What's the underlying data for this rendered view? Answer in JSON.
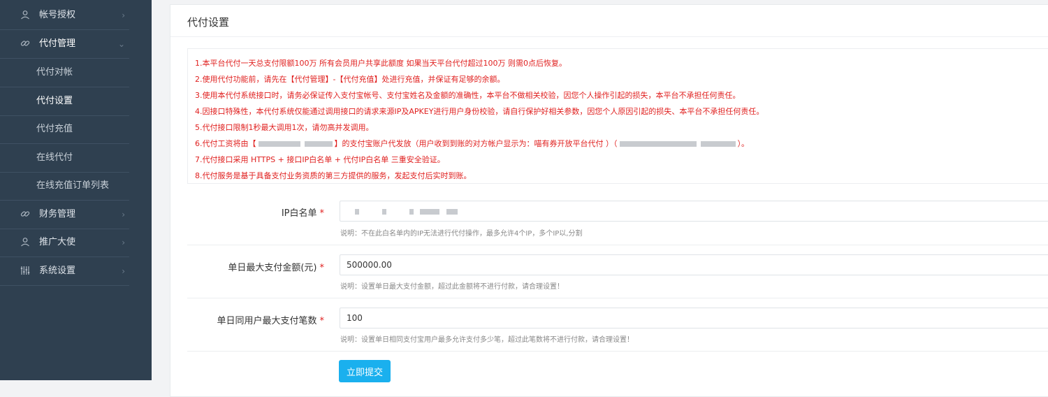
{
  "sidebar": {
    "items": [
      {
        "label": "帐号授权",
        "icon": "user-icon",
        "type": "parent",
        "arrow": "›"
      },
      {
        "label": "代付管理",
        "icon": "link-icon",
        "type": "parent-open",
        "arrow": "⌄"
      },
      {
        "label": "代付对帐",
        "type": "sub"
      },
      {
        "label": "代付设置",
        "type": "sub-active"
      },
      {
        "label": "代付充值",
        "type": "sub"
      },
      {
        "label": "在线代付",
        "type": "sub"
      },
      {
        "label": "在线充值订单列表",
        "type": "sub"
      },
      {
        "label": "财务管理",
        "icon": "link-icon",
        "type": "parent",
        "arrow": "›"
      },
      {
        "label": "推广大使",
        "icon": "user-icon",
        "type": "parent",
        "arrow": "›"
      },
      {
        "label": "系统设置",
        "icon": "sliders-icon",
        "type": "parent",
        "arrow": "›"
      }
    ]
  },
  "panel": {
    "title": "代付设置"
  },
  "notice": {
    "lines": [
      "1.本平台代付一天总支付限额100万 所有会员用户共享此额度 如果当天平台代付超过100万 则需0点后恢复。",
      "2.使用代付功能前，请先在【代付管理】-【代付充值】处进行充值，并保证有足够的余额。",
      "3.使用本代付系统接口时，请务必保证传入支付宝帐号、支付宝姓名及金额的准确性，本平台不做相关校验，因您个人操作引起的损失，本平台不承担任何责任。",
      "4.因接口特殊性，本代付系统仅能通过调用接口的请求来源IP及APKEY进行用户身份校验，请自行保护好相关参数，因您个人原因引起的损失、本平台不承担任何责任。",
      "5.代付接口限制1秒最大调用1次，请勿高并发调用。",
      "6.代付工资将由【",
      "7.代付接口采用 HTTPS + 接口IP白名单 + 代付IP白名单 三重安全验证。",
      "8.代付服务是基于具备支付业务资质的第三方提供的服务，发起支付后实时到账。"
    ],
    "line6_part2": "】的支付宝账户代发放（用户收到到账的对方帐户显示为：喵有券开放平台代付 ）（",
    "line6_part3": "）。"
  },
  "form": {
    "ip_whitelist": {
      "label": "IP白名单",
      "value": "",
      "help": "说明：不在此白名单内的IP无法进行代付操作，最多允许4个IP，多个IP以,分割"
    },
    "daily_max_amount": {
      "label": "单日最大支付金额(元)",
      "value": "500000.00",
      "help": "说明：设置单日最大支付金额，超过此金额将不进行付款，请合理设置！"
    },
    "daily_max_count": {
      "label": "单日同用户最大支付笔数",
      "value": "100",
      "help": "说明：设置单日相同支付宝用户最多允许支付多少笔，超过此笔数将不进行付款，请合理设置！"
    },
    "required_mark": "*",
    "submit_label": "立即提交"
  },
  "colors": {
    "sidebar_bg": "#2f4050",
    "notice_text": "#e0201f",
    "submit_bg": "#1ab0ee"
  }
}
